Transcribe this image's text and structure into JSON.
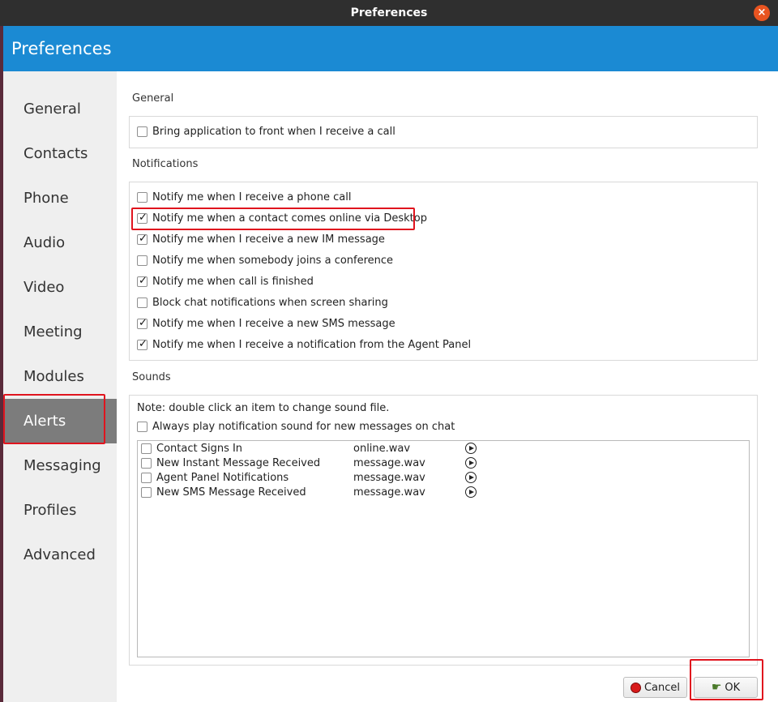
{
  "window": {
    "title": "Preferences",
    "close_glyph": "×",
    "header_title": "Preferences"
  },
  "sidebar": {
    "items": [
      {
        "label": "General",
        "active": false
      },
      {
        "label": "Contacts",
        "active": false
      },
      {
        "label": "Phone",
        "active": false
      },
      {
        "label": "Audio",
        "active": false
      },
      {
        "label": "Video",
        "active": false
      },
      {
        "label": "Meeting",
        "active": false
      },
      {
        "label": "Modules",
        "active": false
      },
      {
        "label": "Alerts",
        "active": true
      },
      {
        "label": "Messaging",
        "active": false
      },
      {
        "label": "Profiles",
        "active": false
      },
      {
        "label": "Advanced",
        "active": false
      }
    ]
  },
  "general": {
    "section_title": "General",
    "options": [
      {
        "label": "Bring application to front when I receive a call",
        "checked": false
      }
    ]
  },
  "notifications": {
    "section_title": "Notifications",
    "options": [
      {
        "label": "Notify me when I receive a phone call",
        "checked": false
      },
      {
        "label": "Notify me when a contact comes online via Desktop",
        "checked": true
      },
      {
        "label": "Notify me when I receive a new IM message",
        "checked": true
      },
      {
        "label": "Notify me when somebody joins a conference",
        "checked": false
      },
      {
        "label": "Notify me when call is finished",
        "checked": true
      },
      {
        "label": "Block chat notifications when screen sharing",
        "checked": false
      },
      {
        "label": "Notify me when I receive a new SMS message",
        "checked": true
      },
      {
        "label": "Notify me when I receive a notification from the Agent Panel",
        "checked": true
      }
    ]
  },
  "sounds": {
    "section_title": "Sounds",
    "note": "Note: double click an item to change sound file.",
    "always_play": {
      "label": "Always play notification sound for new messages on chat",
      "checked": false
    },
    "items": [
      {
        "name": "Contact Signs In",
        "file": "online.wav",
        "checked": false
      },
      {
        "name": "New Instant Message Received",
        "file": "message.wav",
        "checked": false
      },
      {
        "name": "Agent Panel Notifications",
        "file": "message.wav",
        "checked": false
      },
      {
        "name": "New SMS Message Received",
        "file": "message.wav",
        "checked": false
      }
    ]
  },
  "footer": {
    "cancel_label": "Cancel",
    "ok_label": "OK"
  },
  "colors": {
    "accent": "#1b8ad3",
    "highlight_box": "#e0141e",
    "titlebar": "#2f2f2f",
    "close_button": "#e95420"
  }
}
